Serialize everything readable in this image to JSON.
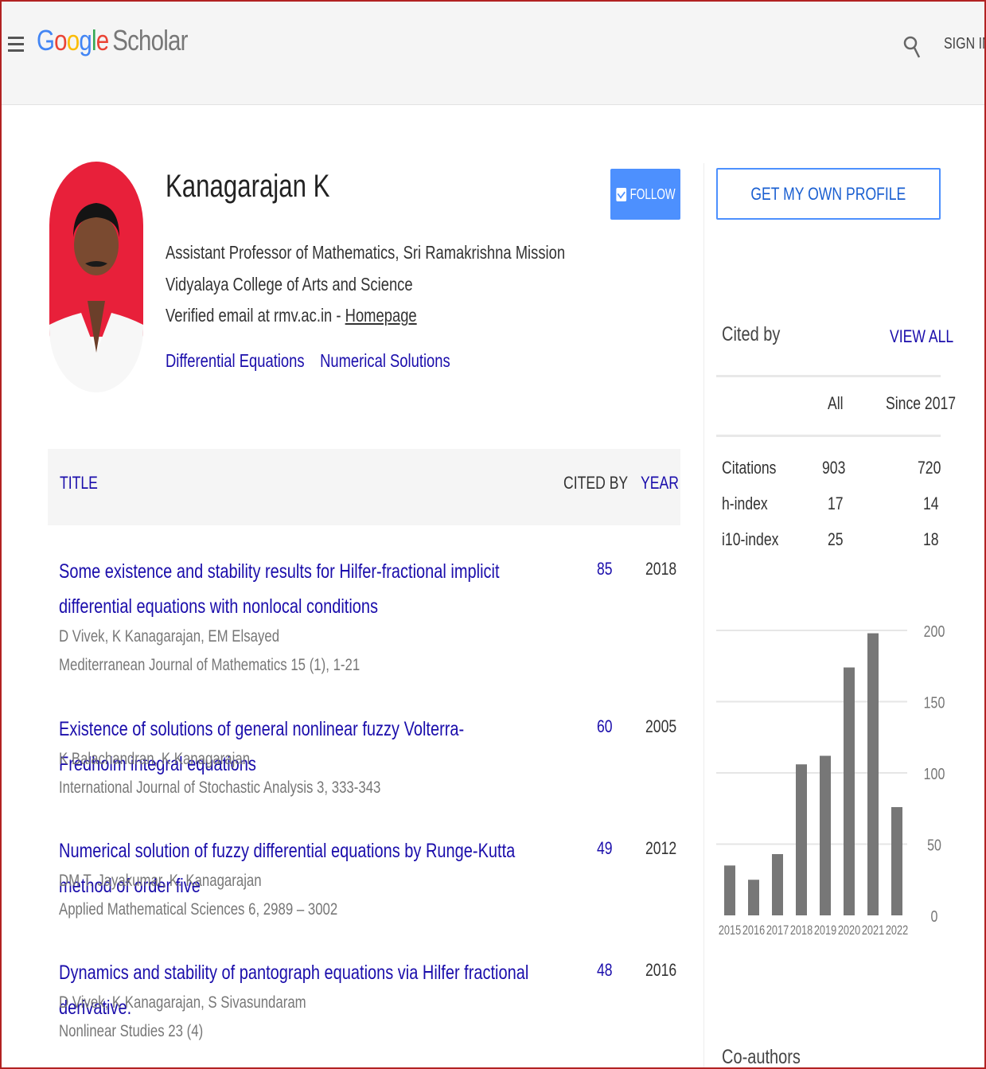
{
  "header": {
    "logo_google": [
      "G",
      "o",
      "o",
      "g",
      "l",
      "e"
    ],
    "logo_product": "Scholar",
    "signin_label": "SIGN IN"
  },
  "profile": {
    "name": "Kanagarajan K",
    "affiliation": "Assistant Professor of Mathematics, Sri Ramakrishna Mission Vidyalaya College of Arts and Science",
    "email_text": "Verified email at rmv.ac.in - ",
    "homepage_label": "Homepage",
    "interests": [
      "Differential Equations",
      "Numerical Solutions"
    ],
    "follow_label": "FOLLOW"
  },
  "table": {
    "headers": {
      "title": "TITLE",
      "cited_by": "CITED BY",
      "year": "YEAR"
    },
    "rows": [
      {
        "title": "Some existence and stability results for Hilfer-fractional implicit differential equations with nonlocal conditions",
        "authors": "D Vivek, K Kanagarajan, EM Elsayed",
        "venue": "Mediterranean Journal of Mathematics 15 (1), 1-21",
        "cited_by": "85",
        "year": "2018"
      },
      {
        "title": "Existence of solutions of general nonlinear fuzzy Volterra-Fredholm integral equations",
        "authors": "K Balachandran, K Kanagarajan",
        "venue": "International Journal of Stochastic Analysis 3, 333-343",
        "cited_by": "60",
        "year": "2005"
      },
      {
        "title": "Numerical solution of fuzzy differential equations by Runge-Kutta method of order five",
        "authors": "DM T. Jayakumar, K. Kanagarajan",
        "venue": "Applied Mathematical Sciences 6, 2989 – 3002",
        "cited_by": "49",
        "year": "2012"
      },
      {
        "title": "Dynamics and stability of pantograph equations via Hilfer fractional derivative.",
        "authors": "D Vivek, K Kanagarajan, S Sivasundaram",
        "venue": "Nonlinear Studies 23 (4)",
        "cited_by": "48",
        "year": "2016"
      }
    ]
  },
  "sidebar": {
    "get_profile_label": "GET MY OWN PROFILE",
    "cited_by_label": "Cited by",
    "view_all_label": "VIEW ALL",
    "col_all": "All",
    "col_since": "Since 2017",
    "stats": [
      {
        "label": "Citations",
        "all": "903",
        "since": "720"
      },
      {
        "label": "h-index",
        "all": "17",
        "since": "14"
      },
      {
        "label": "i10-index",
        "all": "25",
        "since": "18"
      }
    ],
    "coauthors_label": "Co-authors"
  },
  "colors": {
    "link": "#1a0dab",
    "button": "#4d90fe",
    "bar": "#777777"
  },
  "chart_data": {
    "type": "bar",
    "categories": [
      "2015",
      "2016",
      "2017",
      "2018",
      "2019",
      "2020",
      "2021",
      "2022"
    ],
    "values": [
      35,
      25,
      43,
      106,
      112,
      174,
      198,
      76
    ],
    "ylim": [
      0,
      200
    ],
    "yticks": [
      "0",
      "50",
      "100",
      "150",
      "200"
    ],
    "grid": true
  }
}
